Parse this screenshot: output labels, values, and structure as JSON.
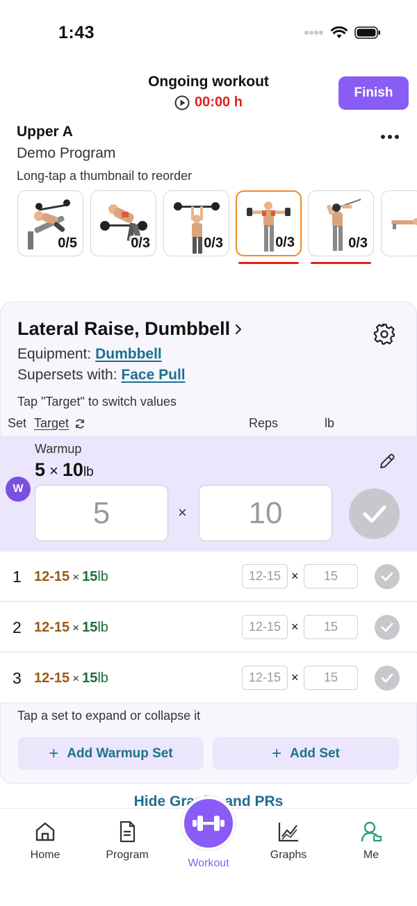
{
  "status_bar": {
    "time": "1:43"
  },
  "header": {
    "title": "Ongoing workout",
    "timer": "00:00 h",
    "finish_label": "Finish"
  },
  "workout": {
    "name": "Upper A",
    "program": "Demo Program",
    "reorder_hint": "Long-tap a thumbnail to reorder"
  },
  "thumbnails": [
    {
      "count": "0/5"
    },
    {
      "count": "0/3"
    },
    {
      "count": "0/3"
    },
    {
      "count": "0/3"
    },
    {
      "count": "0/3"
    },
    {
      "count": ""
    }
  ],
  "exercise": {
    "name": "Lateral Raise, Dumbbell",
    "equipment_label": "Equipment: ",
    "equipment": "Dumbbell",
    "superset_label": "Supersets with: ",
    "superset": "Face Pull",
    "target_hint": "Tap \"Target\" to switch values",
    "columns": {
      "set": "Set",
      "target": "Target",
      "reps": "Reps",
      "weight": "lb"
    }
  },
  "warmup": {
    "label": "Warmup",
    "badge": "W",
    "reps": "5",
    "weight": "10",
    "unit": "lb",
    "times": "×",
    "reps_input": "5",
    "weight_input": "10"
  },
  "sets": [
    {
      "num": "1",
      "reps": "12-15",
      "weight": "15",
      "unit": "lb",
      "reps_input": "12-15",
      "weight_input": "15"
    },
    {
      "num": "2",
      "reps": "12-15",
      "weight": "15",
      "unit": "lb",
      "reps_input": "12-15",
      "weight_input": "15"
    },
    {
      "num": "3",
      "reps": "12-15",
      "weight": "15",
      "unit": "lb",
      "reps_input": "12-15",
      "weight_input": "15"
    }
  ],
  "times": "×",
  "collapse_hint": "Tap a set to expand or collapse it",
  "add_warmup_label": "Add Warmup Set",
  "add_set_label": "Add Set",
  "hide_graphs_label": "Hide Graphs and PRs",
  "tabs": {
    "home": "Home",
    "program": "Program",
    "workout": "Workout",
    "graphs": "Graphs",
    "me": "Me"
  },
  "colors": {
    "accent": "#8a5cf6",
    "timer": "#e0241c",
    "link": "#1d6f8f",
    "active_thumb": "#f08a22",
    "reps_text": "#9a5a12",
    "weight_text": "#1f6a3a"
  },
  "icons": {
    "status": [
      "signal-icon",
      "wifi-icon",
      "battery-icon"
    ],
    "play": "play-circle-icon",
    "more": "more-dots-icon",
    "gear": "gear-icon",
    "rotate": "refresh-icon",
    "pencil": "pencil-icon",
    "check": "check-icon",
    "dumbbell": "dumbbell-icon"
  }
}
